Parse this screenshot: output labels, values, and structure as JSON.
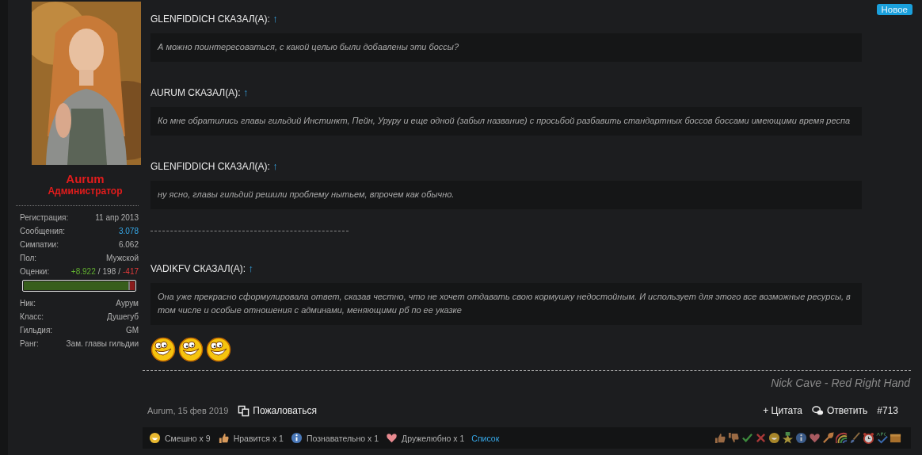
{
  "badge": "Новое",
  "user": {
    "name": "Aurum",
    "role": "Администратор",
    "stats": [
      {
        "label": "Регистрация:",
        "value": "11 апр 2013",
        "kind": "plain"
      },
      {
        "label": "Сообщения:",
        "value": "3.078",
        "kind": "link"
      },
      {
        "label": "Симпатии:",
        "value": "6.062",
        "kind": "plain"
      },
      {
        "label": "Пол:",
        "value": "Мужской",
        "kind": "plain"
      }
    ],
    "ratings": {
      "label": "Оценки:",
      "positive": "+8.922",
      "separators": [
        "/",
        "/"
      ],
      "neutral": "198",
      "negative": "-417"
    },
    "rating_bar": {
      "level": 0.94
    },
    "profile": [
      {
        "label": "Ник:",
        "value": "Аурум"
      },
      {
        "label": "Класс:",
        "value": "Душегуб"
      },
      {
        "label": "Гильдия:",
        "value": "GM"
      },
      {
        "label": "Ранг:",
        "value": "Зам. главы гильдии"
      }
    ]
  },
  "body": [
    {
      "kind": "quote",
      "author": "GLENFIDDICH СКАЗАЛ(А):",
      "arrow": "↑",
      "text": "А можно поинтересоваться, с какой целью были добавлены эти боссы?"
    },
    {
      "kind": "quote",
      "author": "AURUM СКАЗАЛ(А):",
      "arrow": "↑",
      "text": "Ко мне обратились главы гильдий Инстинкт, Пейн, Уруру и еще одной (забыл название) с просьбой разбавить стандартных боссов боссами имеющими время респа"
    },
    {
      "kind": "quote",
      "author": "GLENFIDDICH СКАЗАЛ(А):",
      "arrow": "↑",
      "text": "ну ясно, главы гильдий решили проблему нытьем, впрочем как обычно."
    },
    {
      "kind": "rule"
    },
    {
      "kind": "quote",
      "author": "VADIKFV СКАЗАЛ(А):",
      "arrow": "↑",
      "text": "Она уже прекрасно сформулировала ответ, сказав честно, что не хочет отдавать свою кормушку недостойным. И использует для этого все возможные ресурсы, в том числе и особые отношения с админами, меняющими рб по ее указке"
    },
    {
      "kind": "smileys",
      "items": [
        {
          "kind": "grin"
        },
        {
          "kind": "grin"
        },
        {
          "kind": "grin"
        }
      ]
    }
  ],
  "signature": "Nick Cave - Red Right Hand",
  "meta": {
    "author_date": "Aurum, 15 фев 2019",
    "report": "Пожаловаться",
    "quote": "+ Цитата",
    "reply": "Ответить",
    "post_number": "#713"
  },
  "reactions": [
    {
      "kind": "funny",
      "label": "Смешно x 9"
    },
    {
      "kind": "like",
      "label": "Нравится x 1"
    },
    {
      "kind": "info",
      "label": "Познавательно x 1"
    },
    {
      "kind": "heart",
      "label": "Дружелюбно x 1"
    }
  ],
  "reactions_list": "Список",
  "rate_icons": [
    {
      "kind": "thumbup"
    },
    {
      "kind": "thumbdown"
    },
    {
      "kind": "check"
    },
    {
      "kind": "cross"
    },
    {
      "kind": "smile"
    },
    {
      "kind": "medal"
    },
    {
      "kind": "info"
    },
    {
      "kind": "heart"
    },
    {
      "kind": "wrench"
    },
    {
      "kind": "rainbow"
    },
    {
      "kind": "brush"
    },
    {
      "kind": "clock"
    },
    {
      "kind": "spell"
    },
    {
      "kind": "box"
    }
  ]
}
